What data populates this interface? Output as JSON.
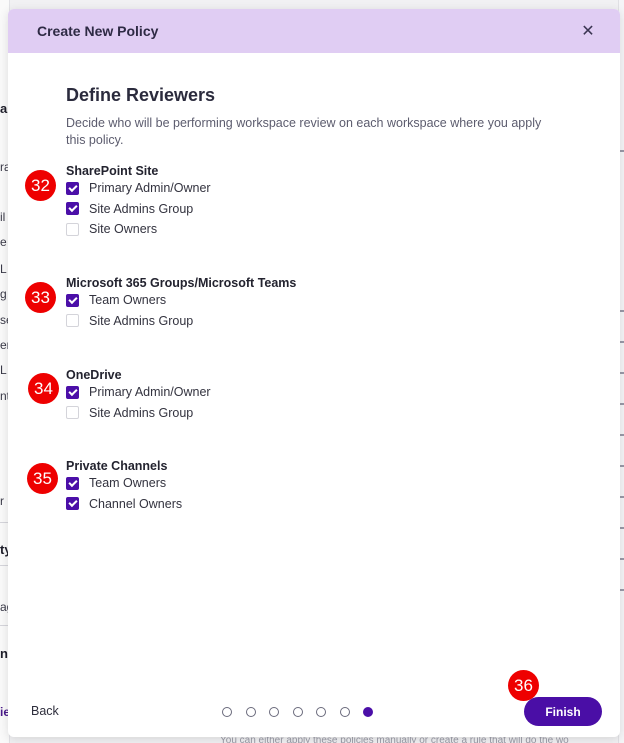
{
  "background": {
    "left_fragments": [
      "al",
      "ra",
      "il",
      "e",
      "L",
      "g",
      "se",
      "er",
      "L",
      "nt",
      "r",
      "ty",
      "ag",
      "n",
      "ie"
    ],
    "bottom_text": "You can either apply these policies manually or create a rule that will do the wo"
  },
  "modal": {
    "title": "Create New Policy",
    "close_icon": "close-icon"
  },
  "page": {
    "title": "Define Reviewers",
    "description": "Decide who will be performing workspace review on each workspace where you apply this policy."
  },
  "groups": [
    {
      "title": "SharePoint Site",
      "badge": "32",
      "options": [
        {
          "label": "Primary Admin/Owner",
          "checked": true
        },
        {
          "label": "Site Admins Group",
          "checked": true
        },
        {
          "label": "Site Owners",
          "checked": false
        }
      ]
    },
    {
      "title": "Microsoft 365 Groups/Microsoft Teams",
      "badge": "33",
      "options": [
        {
          "label": "Team Owners",
          "checked": true
        },
        {
          "label": "Site Admins Group",
          "checked": false
        }
      ]
    },
    {
      "title": "OneDrive",
      "badge": "34",
      "options": [
        {
          "label": "Primary Admin/Owner",
          "checked": true
        },
        {
          "label": "Site Admins Group",
          "checked": false
        }
      ]
    },
    {
      "title": "Private Channels",
      "badge": "35",
      "options": [
        {
          "label": "Team Owners",
          "checked": true
        },
        {
          "label": "Channel Owners",
          "checked": true
        }
      ]
    }
  ],
  "footer": {
    "back_label": "Back",
    "steps_total": 7,
    "current_step": 7,
    "finish_label": "Finish",
    "finish_badge": "36"
  },
  "colors": {
    "header_bg": "#e0cdf3",
    "accent": "#4b0fa8",
    "badge": "#ee0000"
  }
}
